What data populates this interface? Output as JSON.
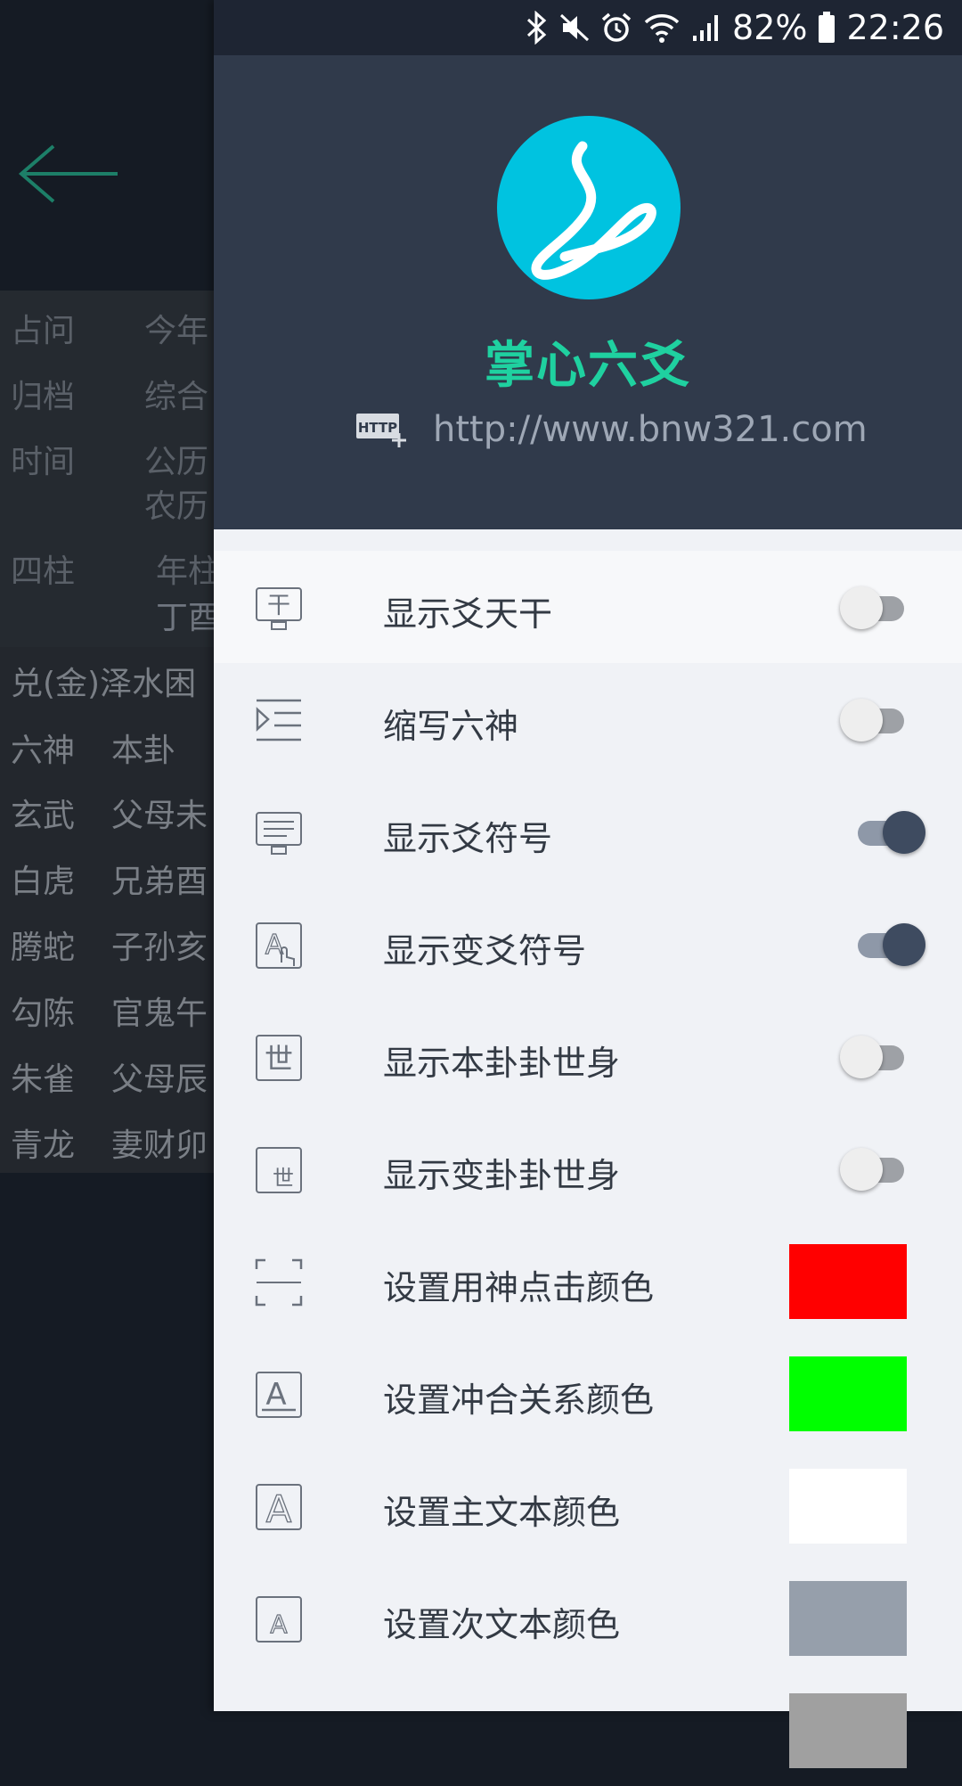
{
  "background": {
    "info_rows": [
      {
        "key": "占问",
        "value": "今年"
      },
      {
        "key": "归档",
        "value": "综合"
      },
      {
        "key": "时间",
        "value": "公历"
      },
      {
        "key": "",
        "value": "农历"
      },
      {
        "key": "四柱",
        "value": "年柱"
      },
      {
        "key": "",
        "value": "丁酉"
      }
    ],
    "gua_name": "兑(金)泽水困",
    "gua_rows": [
      {
        "key": "六神",
        "value": "本卦"
      },
      {
        "key": "玄武",
        "value": "父母未"
      },
      {
        "key": "白虎",
        "value": "兄弟酉"
      },
      {
        "key": "腾蛇",
        "value": "子孙亥"
      },
      {
        "key": "勾陈",
        "value": "官鬼午"
      },
      {
        "key": "朱雀",
        "value": "父母辰"
      },
      {
        "key": "青龙",
        "value": "妻财卯"
      }
    ]
  },
  "status_bar": {
    "battery": "82%",
    "time": "22:26"
  },
  "drawer": {
    "app_name": "掌心六爻",
    "website": "http://www.bnw321.com",
    "http_badge": "HTTP",
    "settings": [
      {
        "label": "显示爻天干",
        "type": "toggle",
        "on": false,
        "icon": "stem-icon",
        "glyph": "干"
      },
      {
        "label": "缩写六神",
        "type": "toggle",
        "on": false,
        "icon": "indent-icon"
      },
      {
        "label": "显示爻符号",
        "type": "toggle",
        "on": true,
        "icon": "symbol-display-icon"
      },
      {
        "label": "显示变爻符号",
        "type": "toggle",
        "on": true,
        "icon": "font-touch-icon",
        "glyph": "A"
      },
      {
        "label": "显示本卦卦世身",
        "type": "toggle",
        "on": false,
        "icon": "shi-icon",
        "glyph": "世"
      },
      {
        "label": "显示变卦卦世身",
        "type": "toggle",
        "on": false,
        "icon": "shi-small-icon",
        "glyph": "世"
      },
      {
        "label": "设置用神点击颜色",
        "type": "color",
        "color": "#ff0000",
        "icon": "select-frame-icon"
      },
      {
        "label": "设置冲合关系颜色",
        "type": "color",
        "color": "#00ff00",
        "icon": "font-underline-icon",
        "glyph": "A"
      },
      {
        "label": "设置主文本颜色",
        "type": "color",
        "color": "#ffffff",
        "icon": "font-outline-icon",
        "glyph": "A"
      },
      {
        "label": "设置次文本颜色",
        "type": "color",
        "color": "#969fab",
        "icon": "font-small-icon",
        "glyph": "A"
      }
    ],
    "partial_swatch_color": "#a0a0a0"
  },
  "colors": {
    "accent": "#1fd1a0",
    "logo": "#00c3e0",
    "header": "#303a4b",
    "toggle_on": "#3e4b60"
  }
}
